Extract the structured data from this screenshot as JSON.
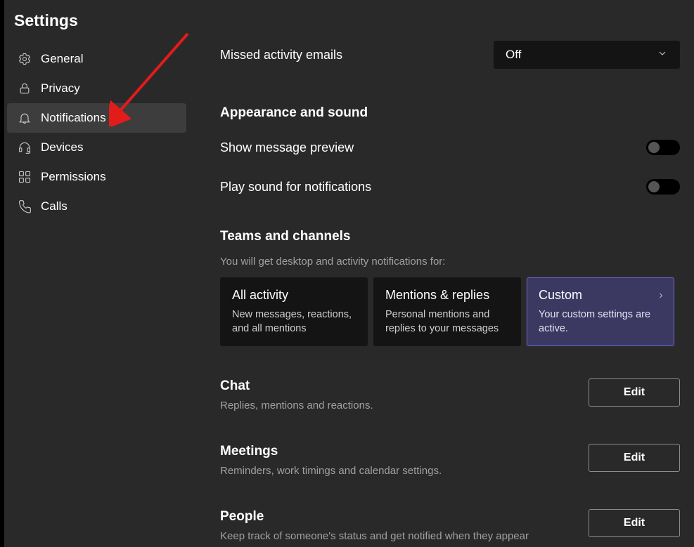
{
  "sidebar": {
    "title": "Settings",
    "items": [
      {
        "label": "General"
      },
      {
        "label": "Privacy"
      },
      {
        "label": "Notifications"
      },
      {
        "label": "Devices"
      },
      {
        "label": "Permissions"
      },
      {
        "label": "Calls"
      }
    ]
  },
  "missedActivity": {
    "label": "Missed activity emails",
    "value": "Off"
  },
  "appearance": {
    "heading": "Appearance and sound",
    "preview_label": "Show message preview",
    "sound_label": "Play sound for notifications"
  },
  "teamsChannels": {
    "heading": "Teams and channels",
    "sub": "You will get desktop and activity notifications for:",
    "cards": [
      {
        "title": "All activity",
        "desc": "New messages, reactions, and all mentions"
      },
      {
        "title": "Mentions & replies",
        "desc": "Personal mentions and replies to your messages"
      },
      {
        "title": "Custom",
        "desc": "Your custom settings are active."
      }
    ]
  },
  "groups": [
    {
      "title": "Chat",
      "desc": "Replies, mentions and reactions.",
      "btn": "Edit"
    },
    {
      "title": "Meetings",
      "desc": "Reminders, work timings and calendar settings.",
      "btn": "Edit"
    },
    {
      "title": "People",
      "desc": "Keep track of someone's status and get notified when they appear",
      "btn": "Edit"
    }
  ]
}
